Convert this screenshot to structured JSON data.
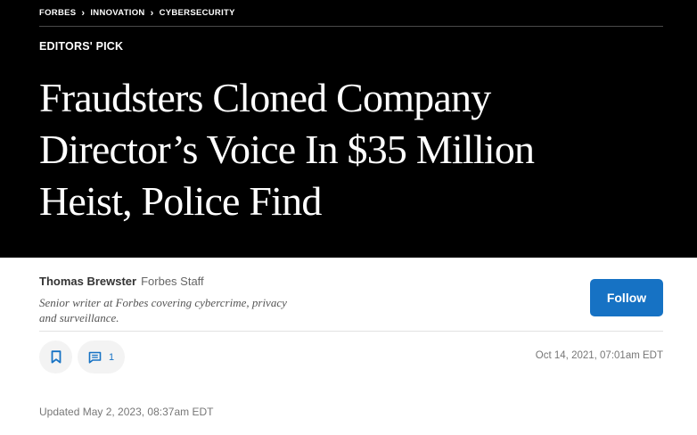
{
  "breadcrumb": {
    "items": [
      "FORBES",
      "INNOVATION",
      "CYBERSECURITY"
    ],
    "separator": "›"
  },
  "article": {
    "label": "EDITORS' PICK",
    "headline_lines": [
      "Fraudsters Cloned Company",
      "Director’s Voice In $35 Million",
      "Heist, Police Find"
    ]
  },
  "author": {
    "name": "Thomas Brewster",
    "role": "Forbes Staff",
    "bio_lines": [
      "Senior writer at Forbes covering cybercrime, privacy",
      "and surveillance."
    ],
    "follow_label": "Follow"
  },
  "actions": {
    "save_icon": "bookmark-icon",
    "comment_icon": "comment-icon",
    "comment_count": "1"
  },
  "meta": {
    "published": "Oct 14, 2021, 07:01am EDT",
    "updated": "Updated May 2, 2023, 08:37am EDT"
  },
  "colors": {
    "hero_bg": "#000000",
    "accent_blue": "#1672c4",
    "action_bg": "#f3f3f3"
  }
}
